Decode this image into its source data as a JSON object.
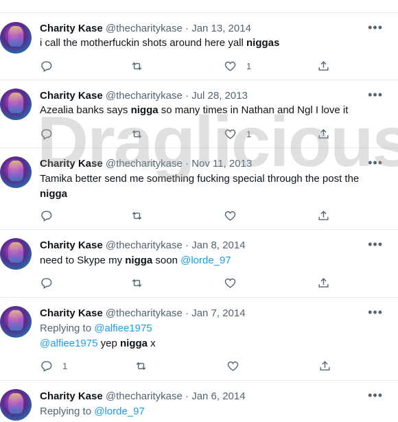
{
  "watermark": "Draglicious",
  "tweets": [
    {
      "name": "Charity Kase",
      "handle": "@thecharitykase",
      "date": "Jan 13, 2014",
      "text_plain1": "i call the motherfuckin shots around here yall ",
      "text_bold1": "niggas",
      "text_plain2": "",
      "likes": "1"
    },
    {
      "name": "Charity Kase",
      "handle": "@thecharitykase",
      "date": "Jul 28, 2013",
      "text_plain1": "Azealia banks says ",
      "text_bold1": "nigga",
      "text_plain2": " so many times in Nathan and Ngl I love it",
      "likes": "1"
    },
    {
      "name": "Charity Kase",
      "handle": "@thecharitykase",
      "date": "Nov 11, 2013",
      "text_plain1": "Tamika better send me something fucking special through the post the ",
      "text_bold1": "nigga",
      "text_plain2": "",
      "likes": ""
    },
    {
      "name": "Charity Kase",
      "handle": "@thecharitykase",
      "date": "Jan 8, 2014",
      "text_plain1": "need to Skype my ",
      "text_bold1": "nigga",
      "text_plain2": " soon ",
      "mention": "@lorde_97",
      "likes": ""
    },
    {
      "name": "Charity Kase",
      "handle": "@thecharitykase",
      "date": "Jan 7, 2014",
      "replying_label": "Replying to ",
      "replying_to": "@alfiee1975",
      "mention": "@alfiee1975",
      "text_plain1": " yep ",
      "text_bold1": "nigga",
      "text_plain2": " x",
      "replies": "1",
      "likes": ""
    },
    {
      "name": "Charity Kase",
      "handle": "@thecharitykase",
      "date": "Jan 6, 2014",
      "replying_label": "Replying to ",
      "replying_to": "@lorde_97"
    }
  ]
}
